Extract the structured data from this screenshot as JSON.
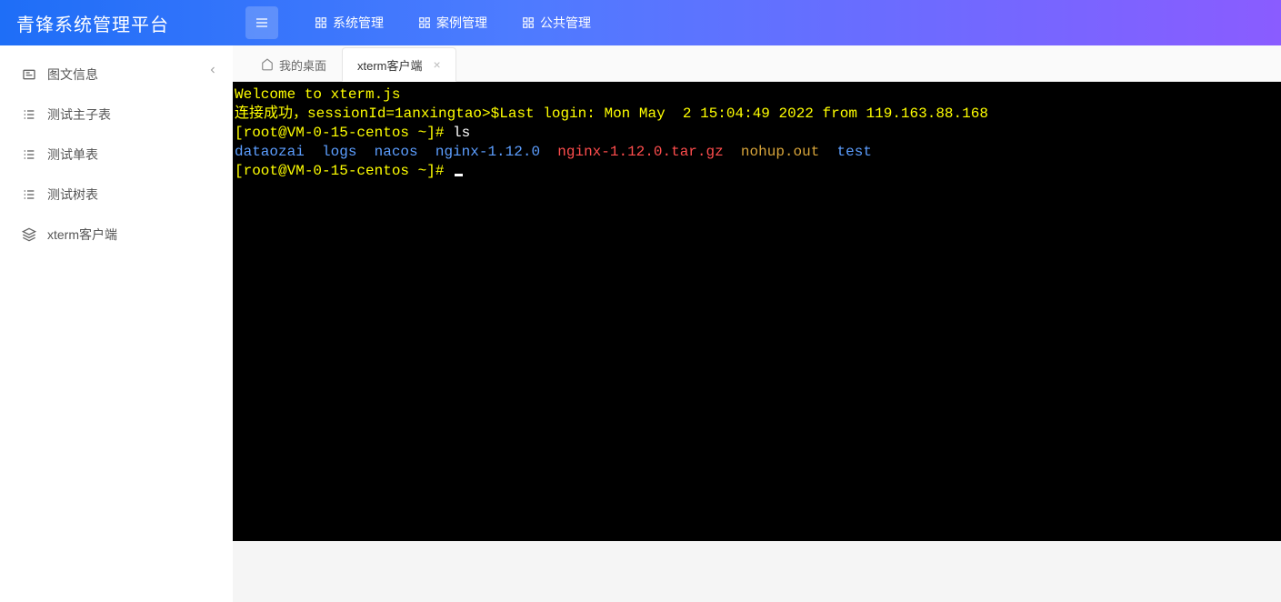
{
  "header": {
    "logo": "青锋系统管理平台",
    "nav": [
      {
        "label": "系统管理"
      },
      {
        "label": "案例管理"
      },
      {
        "label": "公共管理"
      }
    ]
  },
  "sidebar": {
    "items": [
      {
        "label": "图文信息",
        "icon": "list-icon"
      },
      {
        "label": "测试主子表",
        "icon": "list-icon"
      },
      {
        "label": "测试单表",
        "icon": "list-icon"
      },
      {
        "label": "测试树表",
        "icon": "list-icon"
      },
      {
        "label": "xterm客户端",
        "icon": "stack-icon"
      }
    ]
  },
  "tabs": [
    {
      "label": "我的桌面",
      "closable": false
    },
    {
      "label": "xterm客户端",
      "closable": true,
      "active": true
    }
  ],
  "terminal": {
    "welcome": "Welcome to xterm.js",
    "conn_prefix": "连接成功，sessionId=1anxingtao>$",
    "last_login": "Last login: Mon May  2 15:04:49 2022 from 119.163.88.168",
    "prompt1": "[root@VM-0-15-centos ~]# ",
    "cmd1": "ls",
    "ls": {
      "d1": "dataozai",
      "d2": "logs",
      "d3": "nacos",
      "d4": "nginx-1.12.0",
      "f1": "nginx-1.12.0.tar.gz",
      "f2": "nohup.out",
      "d5": "test"
    },
    "prompt2": "[root@VM-0-15-centos ~]# "
  }
}
